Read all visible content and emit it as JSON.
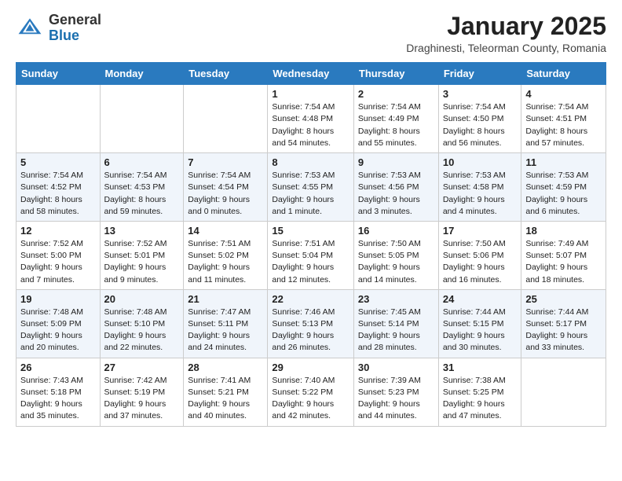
{
  "logo": {
    "general": "General",
    "blue": "Blue"
  },
  "header": {
    "month": "January 2025",
    "location": "Draghinesti, Teleorman County, Romania"
  },
  "weekdays": [
    "Sunday",
    "Monday",
    "Tuesday",
    "Wednesday",
    "Thursday",
    "Friday",
    "Saturday"
  ],
  "weeks": [
    [
      {
        "day": "",
        "content": ""
      },
      {
        "day": "",
        "content": ""
      },
      {
        "day": "",
        "content": ""
      },
      {
        "day": "1",
        "content": "Sunrise: 7:54 AM\nSunset: 4:48 PM\nDaylight: 8 hours\nand 54 minutes."
      },
      {
        "day": "2",
        "content": "Sunrise: 7:54 AM\nSunset: 4:49 PM\nDaylight: 8 hours\nand 55 minutes."
      },
      {
        "day": "3",
        "content": "Sunrise: 7:54 AM\nSunset: 4:50 PM\nDaylight: 8 hours\nand 56 minutes."
      },
      {
        "day": "4",
        "content": "Sunrise: 7:54 AM\nSunset: 4:51 PM\nDaylight: 8 hours\nand 57 minutes."
      }
    ],
    [
      {
        "day": "5",
        "content": "Sunrise: 7:54 AM\nSunset: 4:52 PM\nDaylight: 8 hours\nand 58 minutes."
      },
      {
        "day": "6",
        "content": "Sunrise: 7:54 AM\nSunset: 4:53 PM\nDaylight: 8 hours\nand 59 minutes."
      },
      {
        "day": "7",
        "content": "Sunrise: 7:54 AM\nSunset: 4:54 PM\nDaylight: 9 hours\nand 0 minutes."
      },
      {
        "day": "8",
        "content": "Sunrise: 7:53 AM\nSunset: 4:55 PM\nDaylight: 9 hours\nand 1 minute."
      },
      {
        "day": "9",
        "content": "Sunrise: 7:53 AM\nSunset: 4:56 PM\nDaylight: 9 hours\nand 3 minutes."
      },
      {
        "day": "10",
        "content": "Sunrise: 7:53 AM\nSunset: 4:58 PM\nDaylight: 9 hours\nand 4 minutes."
      },
      {
        "day": "11",
        "content": "Sunrise: 7:53 AM\nSunset: 4:59 PM\nDaylight: 9 hours\nand 6 minutes."
      }
    ],
    [
      {
        "day": "12",
        "content": "Sunrise: 7:52 AM\nSunset: 5:00 PM\nDaylight: 9 hours\nand 7 minutes."
      },
      {
        "day": "13",
        "content": "Sunrise: 7:52 AM\nSunset: 5:01 PM\nDaylight: 9 hours\nand 9 minutes."
      },
      {
        "day": "14",
        "content": "Sunrise: 7:51 AM\nSunset: 5:02 PM\nDaylight: 9 hours\nand 11 minutes."
      },
      {
        "day": "15",
        "content": "Sunrise: 7:51 AM\nSunset: 5:04 PM\nDaylight: 9 hours\nand 12 minutes."
      },
      {
        "day": "16",
        "content": "Sunrise: 7:50 AM\nSunset: 5:05 PM\nDaylight: 9 hours\nand 14 minutes."
      },
      {
        "day": "17",
        "content": "Sunrise: 7:50 AM\nSunset: 5:06 PM\nDaylight: 9 hours\nand 16 minutes."
      },
      {
        "day": "18",
        "content": "Sunrise: 7:49 AM\nSunset: 5:07 PM\nDaylight: 9 hours\nand 18 minutes."
      }
    ],
    [
      {
        "day": "19",
        "content": "Sunrise: 7:48 AM\nSunset: 5:09 PM\nDaylight: 9 hours\nand 20 minutes."
      },
      {
        "day": "20",
        "content": "Sunrise: 7:48 AM\nSunset: 5:10 PM\nDaylight: 9 hours\nand 22 minutes."
      },
      {
        "day": "21",
        "content": "Sunrise: 7:47 AM\nSunset: 5:11 PM\nDaylight: 9 hours\nand 24 minutes."
      },
      {
        "day": "22",
        "content": "Sunrise: 7:46 AM\nSunset: 5:13 PM\nDaylight: 9 hours\nand 26 minutes."
      },
      {
        "day": "23",
        "content": "Sunrise: 7:45 AM\nSunset: 5:14 PM\nDaylight: 9 hours\nand 28 minutes."
      },
      {
        "day": "24",
        "content": "Sunrise: 7:44 AM\nSunset: 5:15 PM\nDaylight: 9 hours\nand 30 minutes."
      },
      {
        "day": "25",
        "content": "Sunrise: 7:44 AM\nSunset: 5:17 PM\nDaylight: 9 hours\nand 33 minutes."
      }
    ],
    [
      {
        "day": "26",
        "content": "Sunrise: 7:43 AM\nSunset: 5:18 PM\nDaylight: 9 hours\nand 35 minutes."
      },
      {
        "day": "27",
        "content": "Sunrise: 7:42 AM\nSunset: 5:19 PM\nDaylight: 9 hours\nand 37 minutes."
      },
      {
        "day": "28",
        "content": "Sunrise: 7:41 AM\nSunset: 5:21 PM\nDaylight: 9 hours\nand 40 minutes."
      },
      {
        "day": "29",
        "content": "Sunrise: 7:40 AM\nSunset: 5:22 PM\nDaylight: 9 hours\nand 42 minutes."
      },
      {
        "day": "30",
        "content": "Sunrise: 7:39 AM\nSunset: 5:23 PM\nDaylight: 9 hours\nand 44 minutes."
      },
      {
        "day": "31",
        "content": "Sunrise: 7:38 AM\nSunset: 5:25 PM\nDaylight: 9 hours\nand 47 minutes."
      },
      {
        "day": "",
        "content": ""
      }
    ]
  ]
}
